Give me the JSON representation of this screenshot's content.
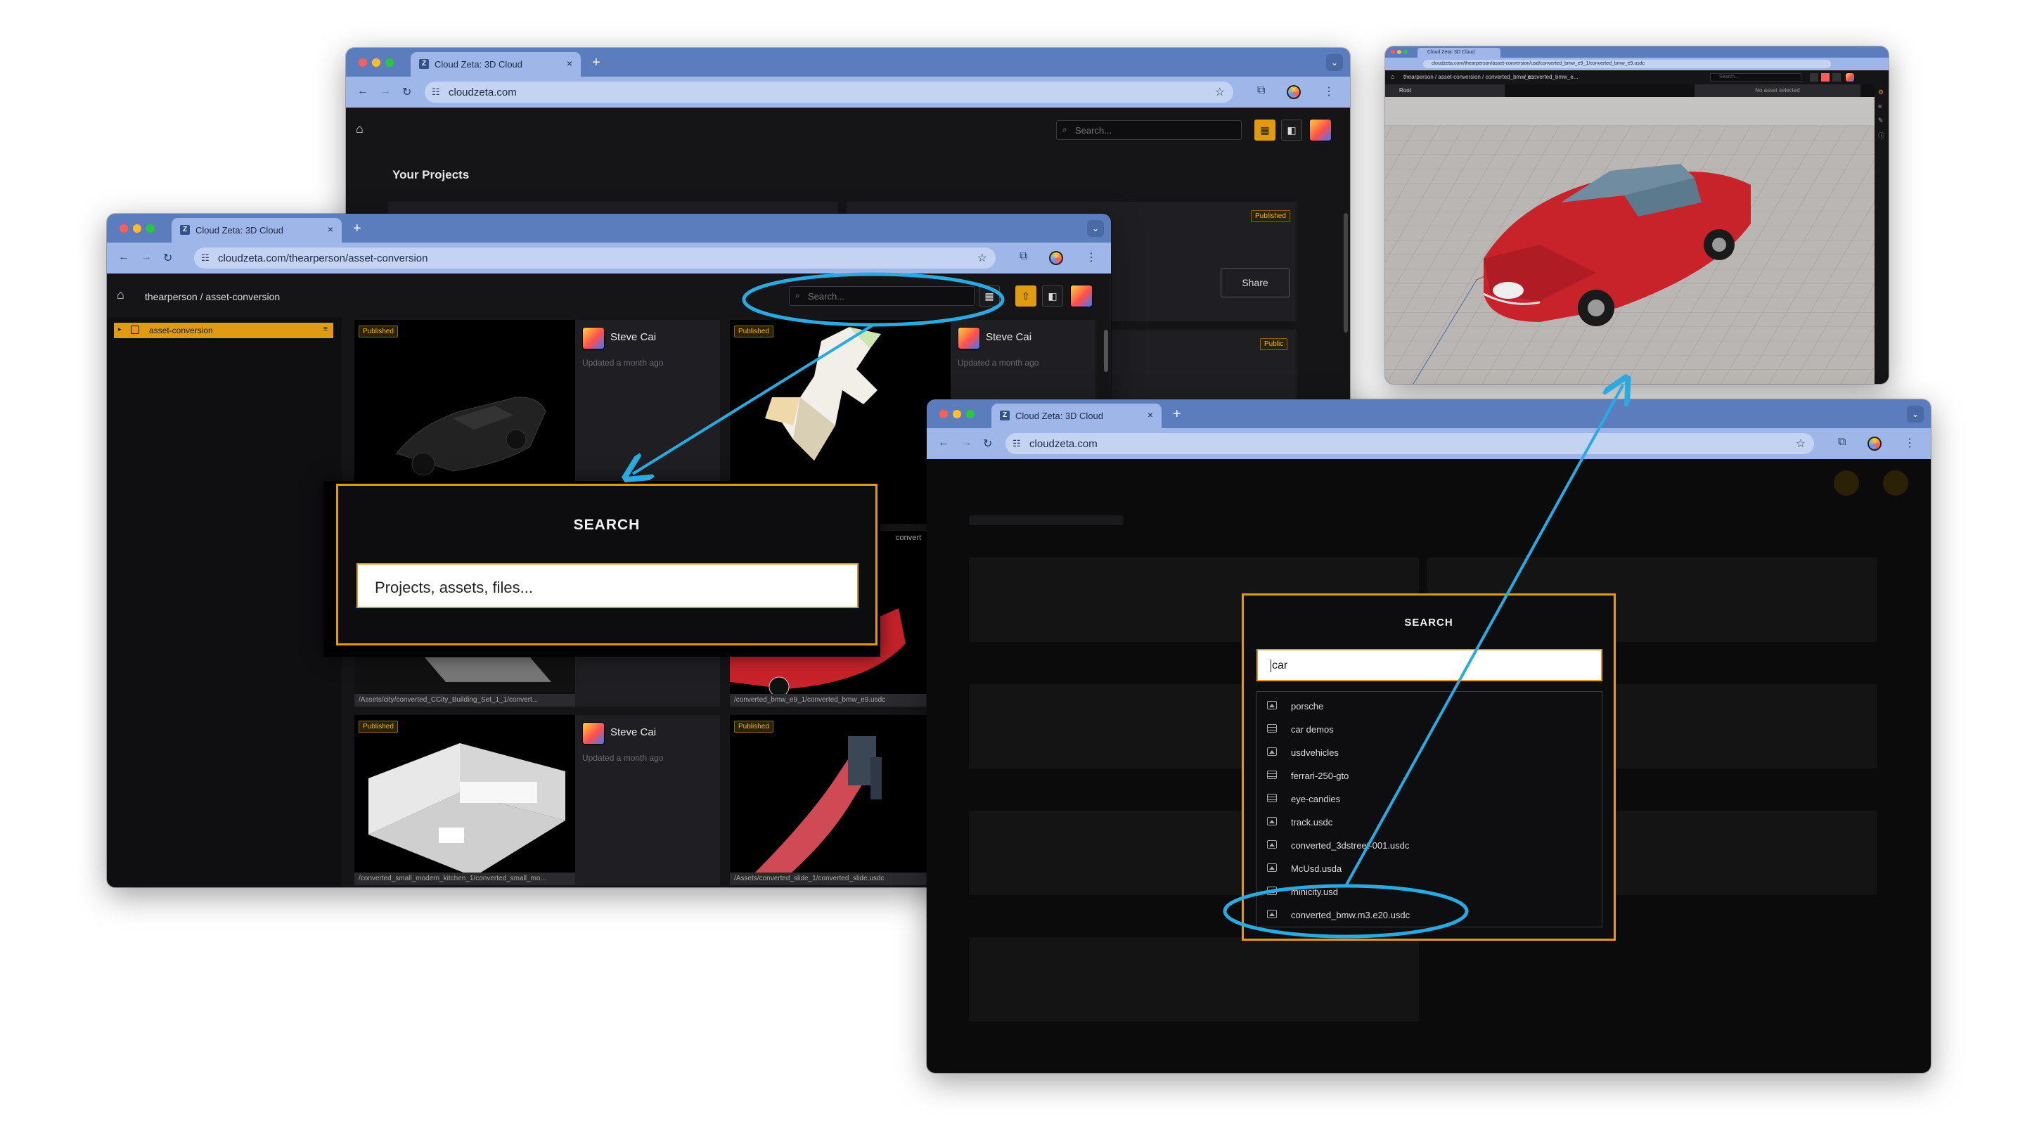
{
  "browser": {
    "tab_title": "Cloud Zeta: 3D Cloud",
    "tab_favicon": "Z",
    "new_tab": "+",
    "close_tab": "×"
  },
  "windows": {
    "projects": {
      "url": "cloudzeta.com",
      "search_placeholder": "Search...",
      "heading": "Your Projects",
      "badges": [
        "Published",
        "Public"
      ],
      "share_label": "Share"
    },
    "asset": {
      "url": "cloudzeta.com/thearperson/asset-conversion",
      "breadcrumb": "thearperson / asset-conversion",
      "search_placeholder": "Search...",
      "sidebar_item": "asset-conversion",
      "cards": [
        {
          "badge": "Published",
          "user": "Steve Cai",
          "updated": "Updated a month ago",
          "path": ""
        },
        {
          "badge": "Published",
          "user": "Steve Cai",
          "updated": "Updated a month ago",
          "path": ""
        },
        {
          "badge": "",
          "user": "",
          "updated": "",
          "path": "/Assets/city/converted_CCity_Building_Set_1_1/convert..."
        },
        {
          "badge": "",
          "user": "",
          "updated": "",
          "path": "/converted_bmw_e9_1/converted_bmw_e9.usdc"
        },
        {
          "badge": "Published",
          "user": "Steve Cai",
          "updated": "Updated a month ago",
          "path": "/converted_small_modern_kitchen_1/converted_small_mo..."
        },
        {
          "badge": "Published",
          "user": "",
          "updated": "",
          "path": "/Assets/converted_slide_1/converted_slide.usdc"
        }
      ],
      "peek_text": "convert"
    },
    "search_callout": {
      "title": "SEARCH",
      "placeholder": "Projects, assets, files..."
    },
    "results": {
      "url": "cloudzeta.com",
      "title": "SEARCH",
      "query": "car",
      "items": [
        {
          "label": "porsche",
          "icon": "image-icon"
        },
        {
          "label": "car demos",
          "icon": "database-icon"
        },
        {
          "label": "usdvehicles",
          "icon": "image-icon"
        },
        {
          "label": "ferrari-250-gto",
          "icon": "database-icon"
        },
        {
          "label": "eye-candies",
          "icon": "database-icon"
        },
        {
          "label": "track.usdc",
          "icon": "image-icon"
        },
        {
          "label": "converted_3dstreet-001.usdc",
          "icon": "image-icon"
        },
        {
          "label": "McUsd.usda",
          "icon": "image-icon"
        },
        {
          "label": "minicity.usd",
          "icon": "image-icon"
        },
        {
          "label": "converted_bmw.m3.e20.usdc",
          "icon": "image-icon"
        }
      ]
    },
    "viewer": {
      "url": "cloudzeta.com/thearperson/asset-conversion/usd/converted_bmw_e9_1/converted_bmw_e9.usdc",
      "breadcrumb_a": "thearperson / asset-conversion / converted_bmw_e...",
      "breadcrumb_b": "/ converted_bmw_e...",
      "search_placeholder": "Search...",
      "panel_left": "Root",
      "panel_right": "No asset selected"
    }
  },
  "colors": {
    "accent": "#e09b12",
    "annotation": "#29abe2",
    "chrome_tabbar": "#5c7dbd",
    "chrome_toolbar": "#9fb7e8",
    "app_bg": "#151517",
    "car_red": "#c8222a"
  }
}
